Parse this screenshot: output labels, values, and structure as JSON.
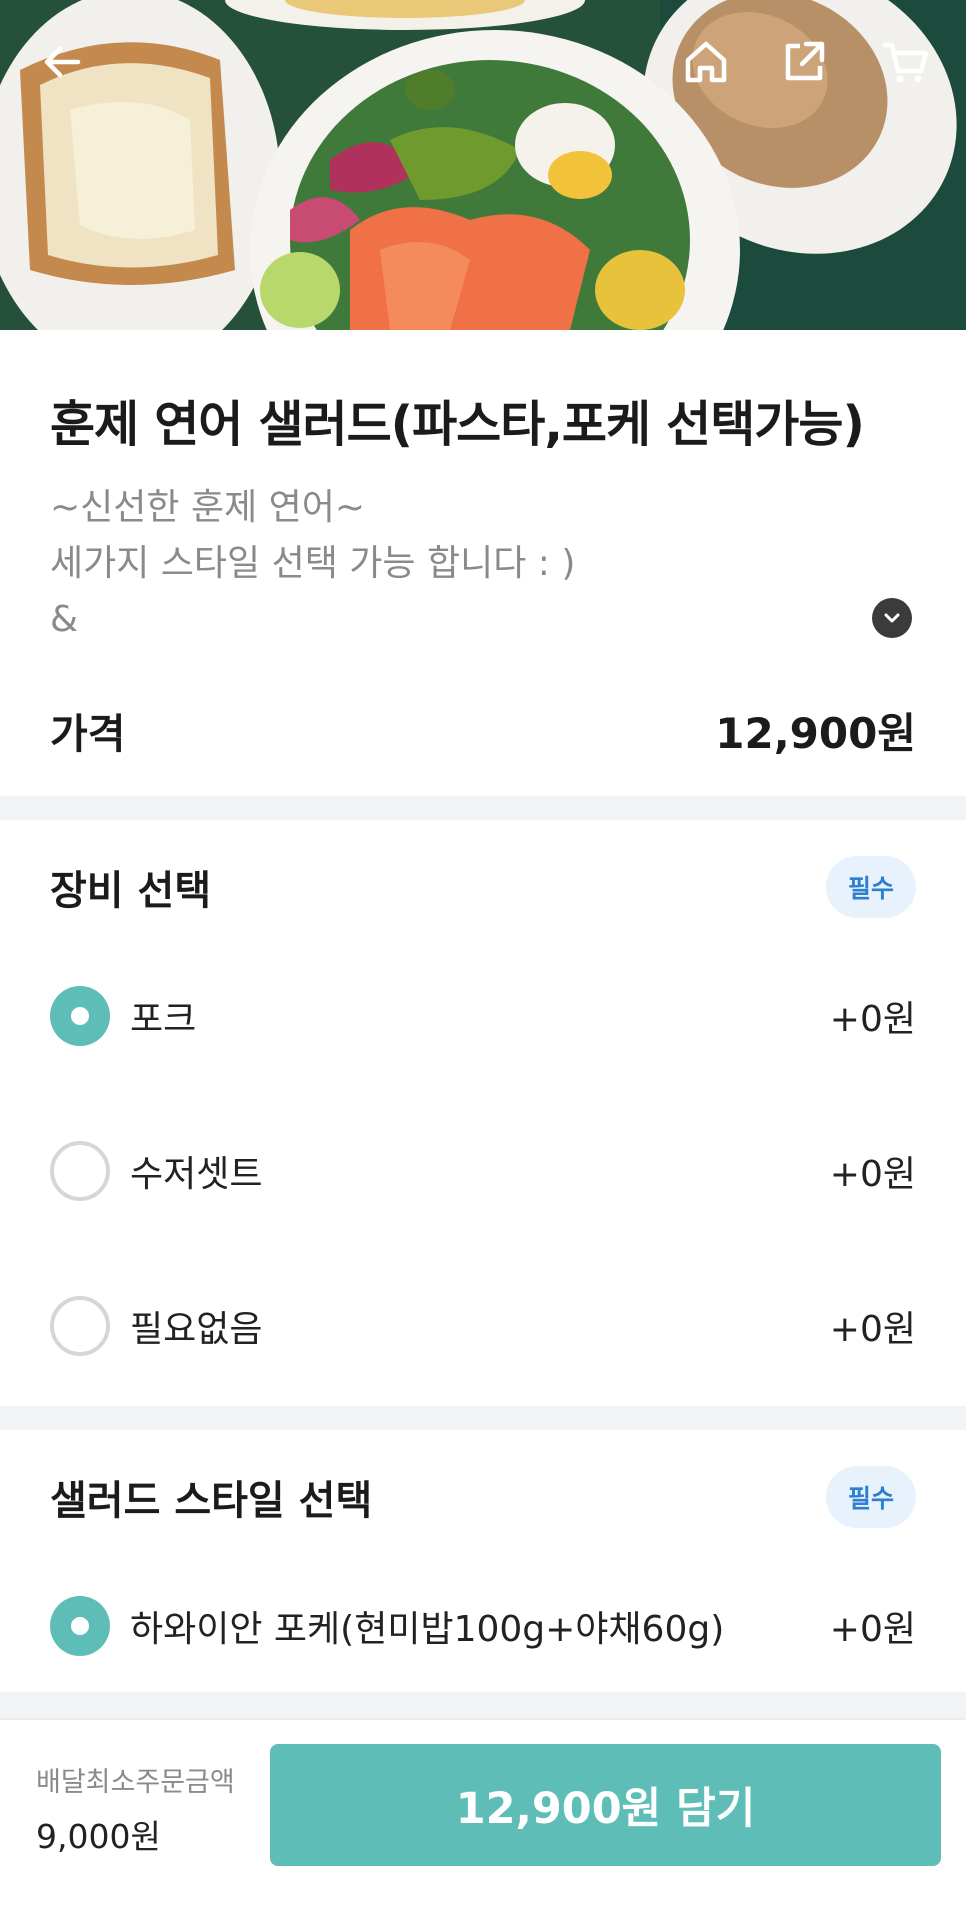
{
  "product": {
    "title": "훈제 연어 샐러드(파스타,포케 선택가능)",
    "description_lines": [
      "~신선한 훈제 연어~",
      "세가지 스타일 선택 가능 합니다 : )",
      "&"
    ],
    "price_label": "가격",
    "price_value": "12,900원"
  },
  "nav": {
    "back_icon": "arrow-left-icon",
    "home_icon": "home-icon",
    "share_icon": "share-icon",
    "cart_icon": "cart-icon"
  },
  "sections": [
    {
      "title": "장비 선택",
      "badge": "필수",
      "options": [
        {
          "label": "포크",
          "price": "+0원",
          "selected": true
        },
        {
          "label": "수저셋트",
          "price": "+0원",
          "selected": false
        },
        {
          "label": "필요없음",
          "price": "+0원",
          "selected": false
        }
      ]
    },
    {
      "title": "샐러드 스타일 선택",
      "badge": "필수",
      "options": [
        {
          "label": "하와이안 포케(현미밥100g+야채60g)",
          "price": "+0원",
          "selected": true
        }
      ]
    }
  ],
  "bottom_bar": {
    "min_order_label": "배달최소주문금액",
    "min_order_value": "9,000원",
    "cta_label": "12,900원 담기"
  },
  "colors": {
    "accent": "#5ebeb7",
    "badge_text": "#2f7fd1",
    "badge_bg": "#e7f2fc",
    "divider": "#f2f3f5"
  }
}
